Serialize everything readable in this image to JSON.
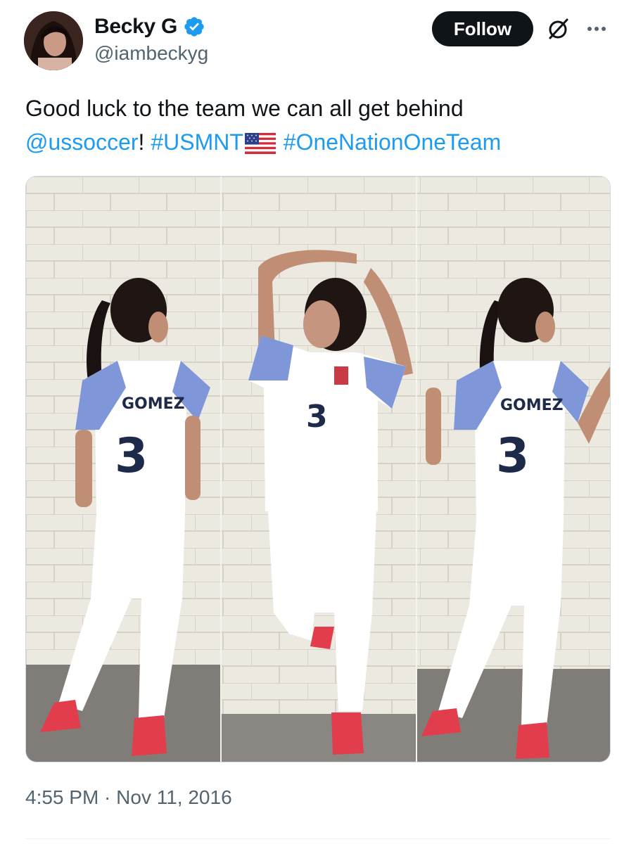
{
  "author": {
    "display_name": "Becky G",
    "handle": "@iambeckyg",
    "verified": true
  },
  "actions": {
    "follow_label": "Follow",
    "grok_icon": "slashed-circle-icon",
    "more_icon": "more-dots-icon"
  },
  "tweet": {
    "text_part1": "Good luck to the team we can all get behind",
    "mention": "@ussoccer",
    "punct": "!",
    "hashtag1": "#USMNT",
    "flag_emoji": "us-flag",
    "hashtag2": "#OneNationOneTeam"
  },
  "media": {
    "panels": [
      {
        "jersey_name": "GOMEZ",
        "jersey_number": "3",
        "pose": "back"
      },
      {
        "jersey_name": "",
        "jersey_number": "3",
        "pose": "front"
      },
      {
        "jersey_name": "GOMEZ",
        "jersey_number": "3",
        "pose": "back"
      }
    ]
  },
  "timestamp": "4:55 PM · Nov 11, 2016",
  "colors": {
    "link": "#1d9bf0",
    "verified": "#1d9bf0",
    "text": "#0f1419",
    "secondary": "#536471"
  }
}
